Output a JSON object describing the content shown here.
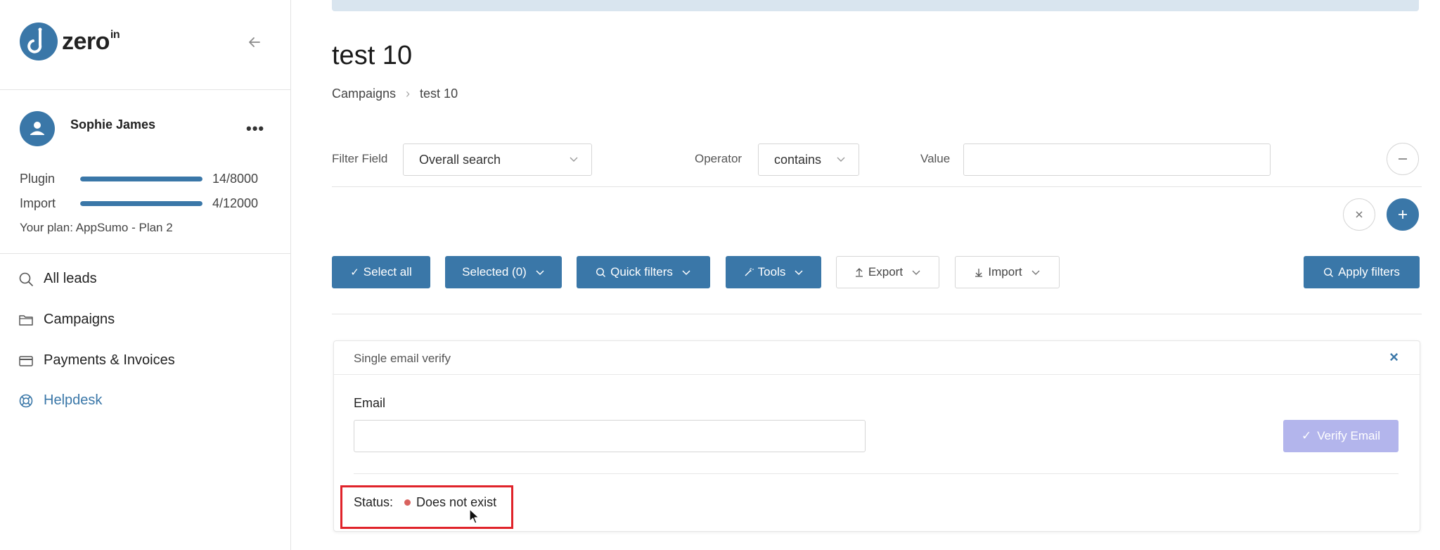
{
  "brand": {
    "name": "zero",
    "sup": "in"
  },
  "user": {
    "name": "Sophie James",
    "more": "•••"
  },
  "usage": [
    {
      "label": "Plugin",
      "count": "14/8000",
      "fraction": 1.0
    },
    {
      "label": "Import",
      "count": "4/12000",
      "fraction": 1.0
    }
  ],
  "plan": "Your plan: AppSumo - Plan 2",
  "nav": [
    {
      "label": "All leads",
      "icon": "search-icon"
    },
    {
      "label": "Campaigns",
      "icon": "folder-icon"
    },
    {
      "label": "Payments & Invoices",
      "icon": "credit-card-icon"
    },
    {
      "label": "Helpdesk",
      "icon": "lifebuoy-icon",
      "active": true
    }
  ],
  "page": {
    "title": "test 10",
    "breadcrumb": [
      "Campaigns",
      "test 10"
    ]
  },
  "filter": {
    "field_label": "Filter Field",
    "field_value": "Overall search",
    "operator_label": "Operator",
    "operator_value": "contains",
    "value_label": "Value",
    "value_value": ""
  },
  "toolbar": {
    "select_all": "Select all",
    "selected": "Selected (0)",
    "quick_filters": "Quick filters",
    "tools": "Tools",
    "export": "Export",
    "import": "Import",
    "apply_filters": "Apply filters"
  },
  "verify_card": {
    "title": "Single email verify",
    "close": "×",
    "email_label": "Email",
    "email_value": "",
    "verify_button": "Verify Email",
    "status_label": "Status:",
    "status_value": "Does not exist"
  },
  "colors": {
    "accent": "#3a77a8",
    "verify_disabled": "#b3b5ec",
    "status_error": "#d9625e",
    "highlight": "#e0232a"
  }
}
